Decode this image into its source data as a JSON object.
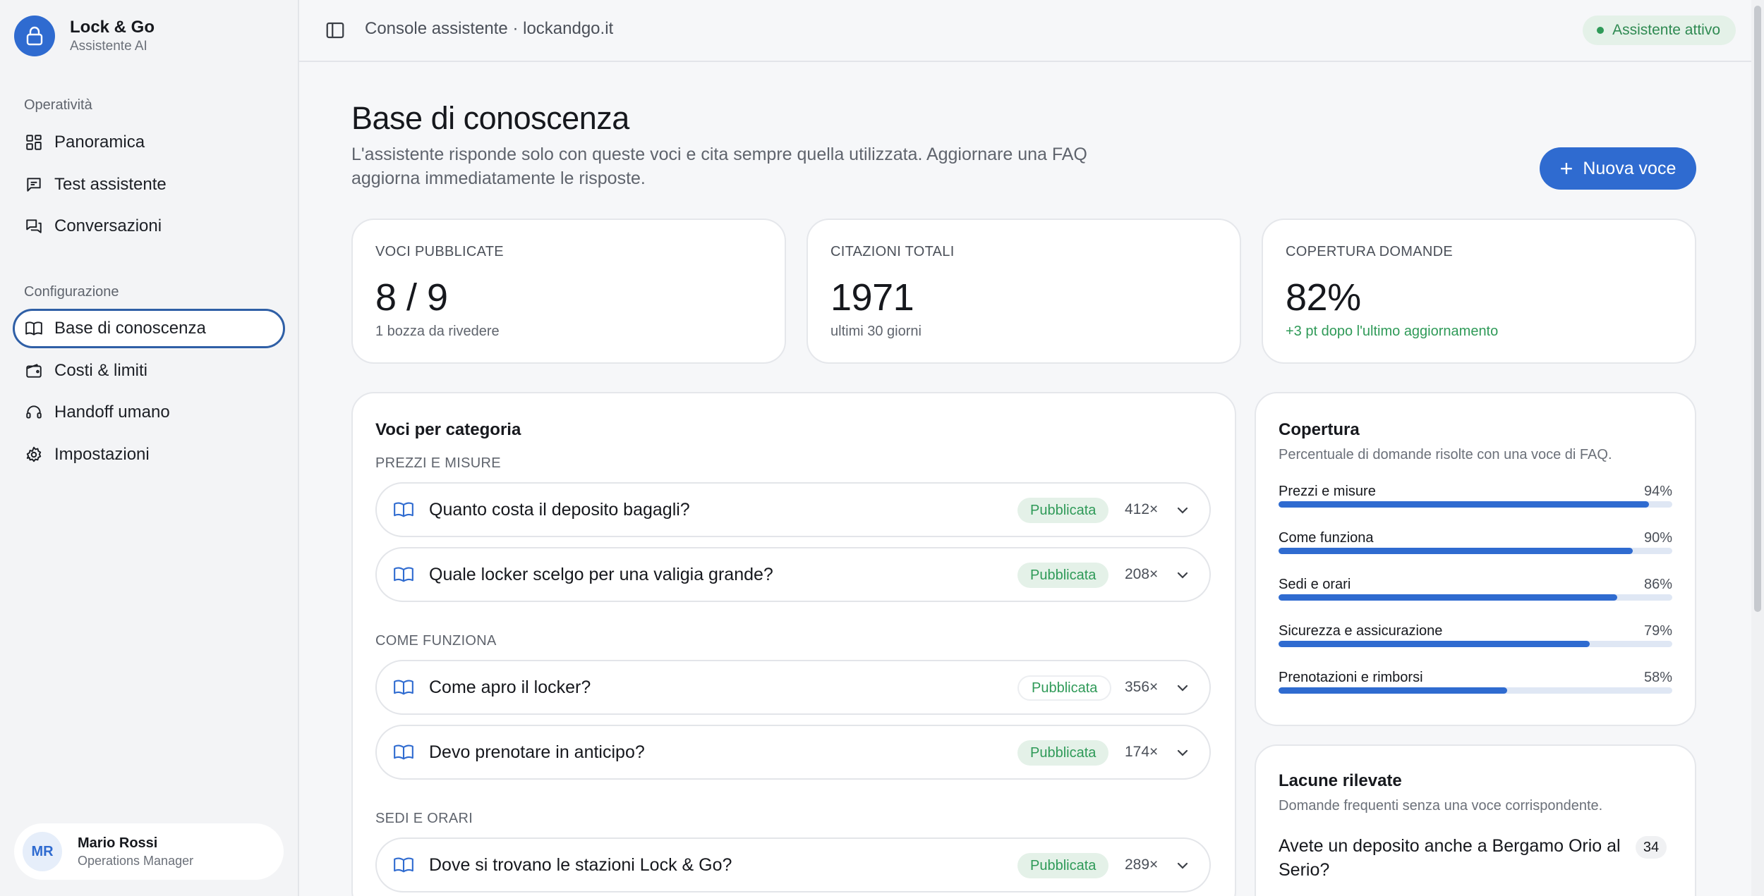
{
  "brand": {
    "name": "Lock & Go",
    "subtitle": "Assistente AI",
    "logo_icon": "lock-icon"
  },
  "sidebar": {
    "section_operativita": "Operatività",
    "section_configurazione": "Configurazione",
    "items": [
      {
        "label": "Panoramica",
        "icon": "grid-icon"
      },
      {
        "label": "Test assistente",
        "icon": "chat-icon"
      },
      {
        "label": "Conversazioni",
        "icon": "conversations-icon"
      },
      {
        "label": "Base di conoscenza",
        "icon": "book-icon",
        "active": true
      },
      {
        "label": "Costi & limiti",
        "icon": "wallet-icon"
      },
      {
        "label": "Handoff umano",
        "icon": "headset-icon"
      },
      {
        "label": "Impostazioni",
        "icon": "gear-icon"
      }
    ],
    "user": {
      "initials": "MR",
      "name": "Mario Rossi",
      "role": "Operations Manager"
    }
  },
  "topbar": {
    "title": "Console assistente · lockandgo.it",
    "status": "Assistente attivo"
  },
  "main": {
    "title": "Base di conoscenza",
    "description": "L'assistente risponde solo con queste voci e cita sempre quella utilizzata. Aggiornare una FAQ aggiorna immediatamente le risposte.",
    "new_button": "Nuova voce",
    "stats": [
      {
        "label": "VOCI PUBBLICATE",
        "value": "8 / 9",
        "note": "1 bozza da rivedere"
      },
      {
        "label": "CITAZIONI TOTALI",
        "value": "1971",
        "note": "ultimi 30 giorni"
      },
      {
        "label": "COPERTURA DOMANDE",
        "value": "82%",
        "note": "+3 pt dopo l'ultimo aggiornamento"
      }
    ],
    "categories_panel": {
      "title": "Voci per categoria",
      "groups": [
        {
          "name": "PREZZI E MISURE",
          "items": [
            {
              "question": "Quanto costa il deposito bagagli?",
              "status": "Pubblicata",
              "count": "412×"
            },
            {
              "question": "Quale locker scelgo per una valigia grande?",
              "status": "Pubblicata",
              "count": "208×"
            }
          ]
        },
        {
          "name": "COME FUNZIONA",
          "items": [
            {
              "question": "Come apro il locker?",
              "status": "Pubblicata",
              "count": "356×"
            },
            {
              "question": "Devo prenotare in anticipo?",
              "status": "Pubblicata",
              "count": "174×"
            }
          ]
        },
        {
          "name": "SEDI E ORARI",
          "items": [
            {
              "question": "Dove si trovano le stazioni Lock & Go?",
              "status": "Pubblicata",
              "count": "289×"
            }
          ]
        }
      ]
    },
    "coverage_panel": {
      "title": "Copertura",
      "subtitle": "Percentuale di domande risolte con una voce di FAQ.",
      "rows": [
        {
          "label": "Prezzi e misure",
          "value": "94%",
          "pct": 94
        },
        {
          "label": "Come funziona",
          "value": "90%",
          "pct": 90
        },
        {
          "label": "Sedi e orari",
          "value": "86%",
          "pct": 86
        },
        {
          "label": "Sicurezza e assicurazione",
          "value": "79%",
          "pct": 79
        },
        {
          "label": "Prenotazioni e rimborsi",
          "value": "58%",
          "pct": 58
        }
      ]
    },
    "gaps_panel": {
      "title": "Lacune rilevate",
      "subtitle": "Domande frequenti senza una voce corrispondente.",
      "items": [
        {
          "question": "Avete un deposito anche a Bergamo Orio al Serio?",
          "count": "34"
        }
      ]
    }
  },
  "colors": {
    "accent": "#2f6bd0",
    "success": "#2f9a58",
    "success_bg": "#e4f1e8"
  }
}
